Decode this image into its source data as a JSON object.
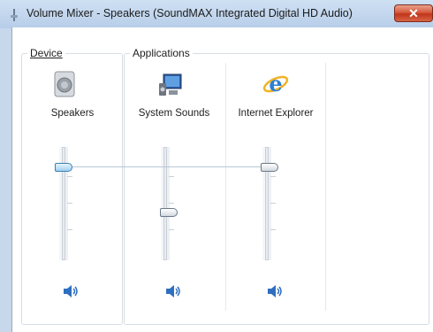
{
  "window": {
    "title": "Volume Mixer - Speakers (SoundMAX Integrated Digital HD Audio)",
    "close_label": "✕"
  },
  "groups": {
    "device_label": "Device",
    "applications_label": "Applications"
  },
  "channels": [
    {
      "label": "Speakers",
      "icon": "speaker-device-icon",
      "volume_fraction": 0.82
    },
    {
      "label": "System Sounds",
      "icon": "system-sounds-icon",
      "volume_fraction": 0.42
    },
    {
      "label": "Internet Explorer",
      "icon": "internet-explorer-icon",
      "volume_fraction": 0.82
    }
  ],
  "colors": {
    "accent": "#3c7fb1",
    "title_bar": "#c7d8ec"
  }
}
